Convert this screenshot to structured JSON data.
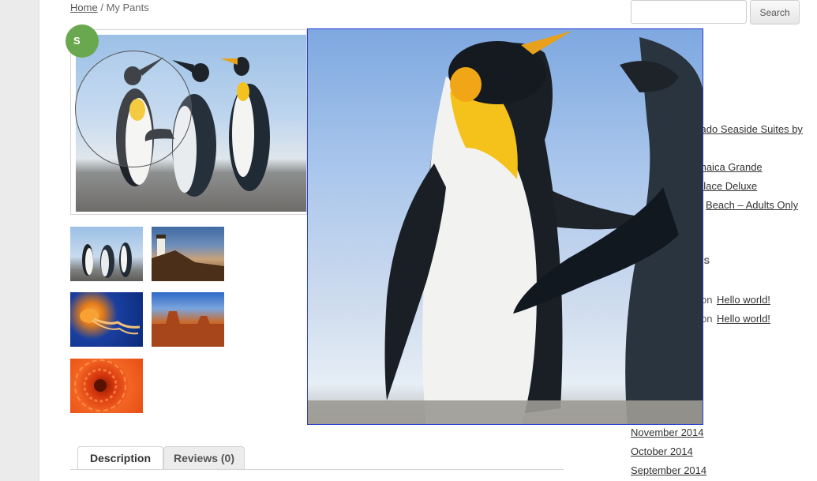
{
  "breadcrumb": {
    "home": "Home",
    "separator": "/",
    "current": "My Pants"
  },
  "sale_badge": "S",
  "thumbnails": [
    {
      "name": "penguins"
    },
    {
      "name": "lighthouse"
    },
    {
      "name": "jellyfish"
    },
    {
      "name": "desert"
    },
    {
      "name": "flower"
    }
  ],
  "tabs": {
    "description": "Description",
    "reviews": "Reviews (0)"
  },
  "sidebar": {
    "search_button": "Search",
    "products": [
      "orado Seaside Suites by",
      "maica Grande",
      "alace Deluxe",
      "Beach – Adults Only"
    ],
    "recent_comments_heading": "NTS",
    "comments": [
      {
        "on": "on",
        "link": "Hello world!"
      },
      {
        "on": "on",
        "link": "Hello world!"
      }
    ],
    "archives": [
      "November 2014",
      "October 2014",
      "September 2014"
    ]
  },
  "colors": {
    "sale_badge": "#6aa84f",
    "zoom_border": "#2a3fd6"
  }
}
